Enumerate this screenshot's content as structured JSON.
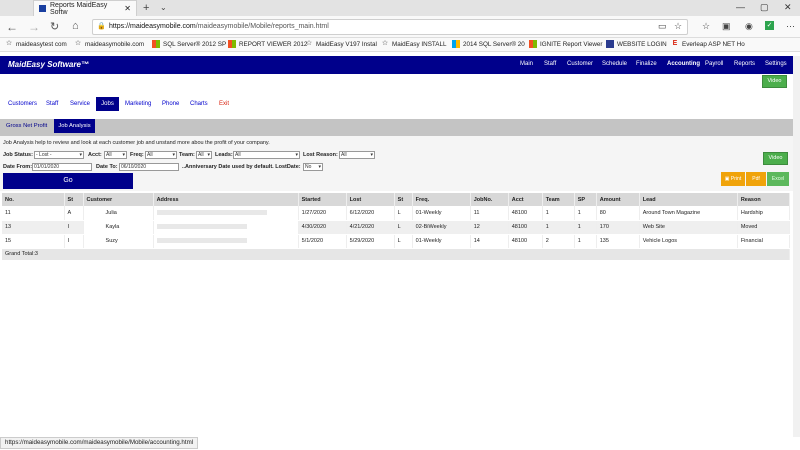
{
  "browser": {
    "tab_title": "Reports MaidEasy Softw",
    "url_domain": "https://maideasymobile.com",
    "url_path": "/maideasymobile/Mobile/reports_main.html",
    "status_url": "https://maideasymobile.com/maideasymobile/Mobile/accounting.html"
  },
  "favorites": [
    {
      "label": "maideasytest com",
      "icon": "star"
    },
    {
      "label": "maideasymobile.com",
      "icon": "star"
    },
    {
      "label": "SQL Server® 2012 SP",
      "icon": "ms"
    },
    {
      "label": "REPORT VIEWER 2012",
      "icon": "ms"
    },
    {
      "label": "MaidEasy V197 Instal",
      "icon": "star"
    },
    {
      "label": "MaidEasy INSTALL",
      "icon": "star"
    },
    {
      "label": "2014 SQL Server® 20",
      "icon": "ms"
    },
    {
      "label": "IGNITE Report Viewer",
      "icon": "ms"
    },
    {
      "label": "WEBSITE LOGIN",
      "icon": "page"
    },
    {
      "label": "Everleap ASP NET Ho",
      "icon": "e"
    }
  ],
  "app": {
    "logo": "MaidEasy Software™",
    "topnav": [
      "Main",
      "Staff",
      "Customer",
      "Schedule",
      "Finalize",
      "Accounting",
      "Payroll",
      "Reports",
      "Settings"
    ],
    "video_label": "Video"
  },
  "subnav": [
    "Customers",
    "Staff",
    "Service",
    "Jobs",
    "Marketing",
    "Phone",
    "Charts",
    "Exit"
  ],
  "subtabs": [
    "Gross Net Profit",
    "Job Analysis"
  ],
  "description": "Job Analysis help to review and look at each customer job and unstand more abou the profit of your company.",
  "filters": {
    "job_status_label": "Job Status:",
    "job_status_value": "- Lost -",
    "acct_label": "Acct:",
    "acct_value": "All",
    "freq_label": "Freq:",
    "freq_value": "All",
    "team_label": "Team:",
    "team_value": "All",
    "leads_label": "Leads:",
    "leads_value": "All",
    "lost_reason_label": "Lost Reason:",
    "lost_reason_value": "All",
    "date_from_label": "Date From:",
    "date_from_value": "01/01/2020",
    "date_to_label": "Date To:",
    "date_to_value": "06/10/2020",
    "anniversary_label": "..Anniversary Date used by default. LostDate:",
    "anniversary_value": "No",
    "go_label": "Go",
    "video_label": "Video",
    "print_label": "Print",
    "pdf_label": "Pdf",
    "excel_label": "Excel"
  },
  "table": {
    "headers": [
      "No.",
      "St",
      "Customer",
      "Address",
      "Started",
      "Lost",
      "St",
      "Freq.",
      "JobNo.",
      "Acct",
      "Team",
      "SP",
      "Amount",
      "Lead",
      "Reason"
    ],
    "rows": [
      {
        "no": "11",
        "st": "A",
        "customer": "Julia",
        "started": "1/27/2020",
        "lost": "6/12/2020",
        "st2": "L",
        "freq": "01-Weekly",
        "jobno": "11",
        "acct": "48100",
        "team": "1",
        "sp": "1",
        "amount": "80",
        "lead": "Around Town Magazine",
        "reason": "Hardship"
      },
      {
        "no": "13",
        "st": "I",
        "customer": "Kayla",
        "started": "4/30/2020",
        "lost": "4/21/2020",
        "st2": "L",
        "freq": "02-BiWeekly",
        "jobno": "12",
        "acct": "48100",
        "team": "1",
        "sp": "1",
        "amount": "170",
        "lead": "Web Site",
        "reason": "Moved"
      },
      {
        "no": "15",
        "st": "I",
        "customer": "Suzy",
        "started": "5/1/2020",
        "lost": "5/29/2020",
        "st2": "L",
        "freq": "01-Weekly",
        "jobno": "14",
        "acct": "48100",
        "team": "2",
        "sp": "1",
        "amount": "135",
        "lead": "Vehicle Logos",
        "reason": "Financial"
      }
    ],
    "total_label": "Grand Total:3"
  },
  "colors": {
    "navy": "#00008b",
    "green": "#4cae4c",
    "orange": "#f0a30a",
    "exit_red": "#d9230f"
  }
}
